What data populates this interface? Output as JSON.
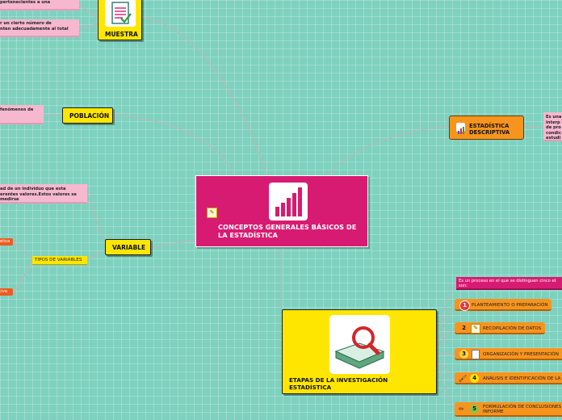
{
  "central": {
    "title": "CONCEPTOS GENERALES BÁSICOS DE LA ESTADÍSTICA",
    "icon": "bar-chart-icon",
    "color": "#d81b72"
  },
  "muestra": {
    "label": "MUESTRA",
    "icon": "document-checklist-icon"
  },
  "muestra_notes": [
    "pertenecientes a una",
    "r un cierto número de\nnten adecuadamente al total"
  ],
  "poblacion": {
    "label": "POBLACIÓN"
  },
  "poblacion_note": "fenómenos de",
  "variable": {
    "label": "VARIABLE"
  },
  "variable_note": "ad de un individuo que esta\nerentes valores.Estos valores se\nmedirse",
  "tipos": {
    "label": "TIPOS DE VARIABLES"
  },
  "tipos_items": [
    "ativa",
    "tiva"
  ],
  "descriptiva": {
    "label": "ESTADÍSTICA DESCRIPTIVA",
    "icon": "chart-icon",
    "note": "Es una\ninterp\nde pro\ncondic\nestudi"
  },
  "etapas": {
    "label": "ETAPAS DE LA INVESTIGACIÓN ESTADÍSTICA",
    "icon": "book-magnifier-icon",
    "intro": "Es un proceso en el que se distinguen cinco et\nson:",
    "steps": [
      {
        "num": "1",
        "text": "PLANTEAMIENTO O PREPARACIÓN"
      },
      {
        "num": "2",
        "text": "RECOPILACIÓN DE DATOS"
      },
      {
        "num": "3",
        "text": "ORGANIZACIÓN Y PRESENTACIÓN"
      },
      {
        "num": "4",
        "text": "ANÁLISIS E IDENTIFICACIÓN DE LA"
      },
      {
        "num": "5",
        "text": "FORMULACIÓN DE CONCLUSIONES\nINFORME"
      }
    ]
  },
  "colors": {
    "background": "#7fd1bf",
    "yellow": "#ffe600",
    "pink": "#f6b8cf",
    "magenta": "#d81b72",
    "orange": "#f7941e",
    "red": "#ef5b1e"
  }
}
